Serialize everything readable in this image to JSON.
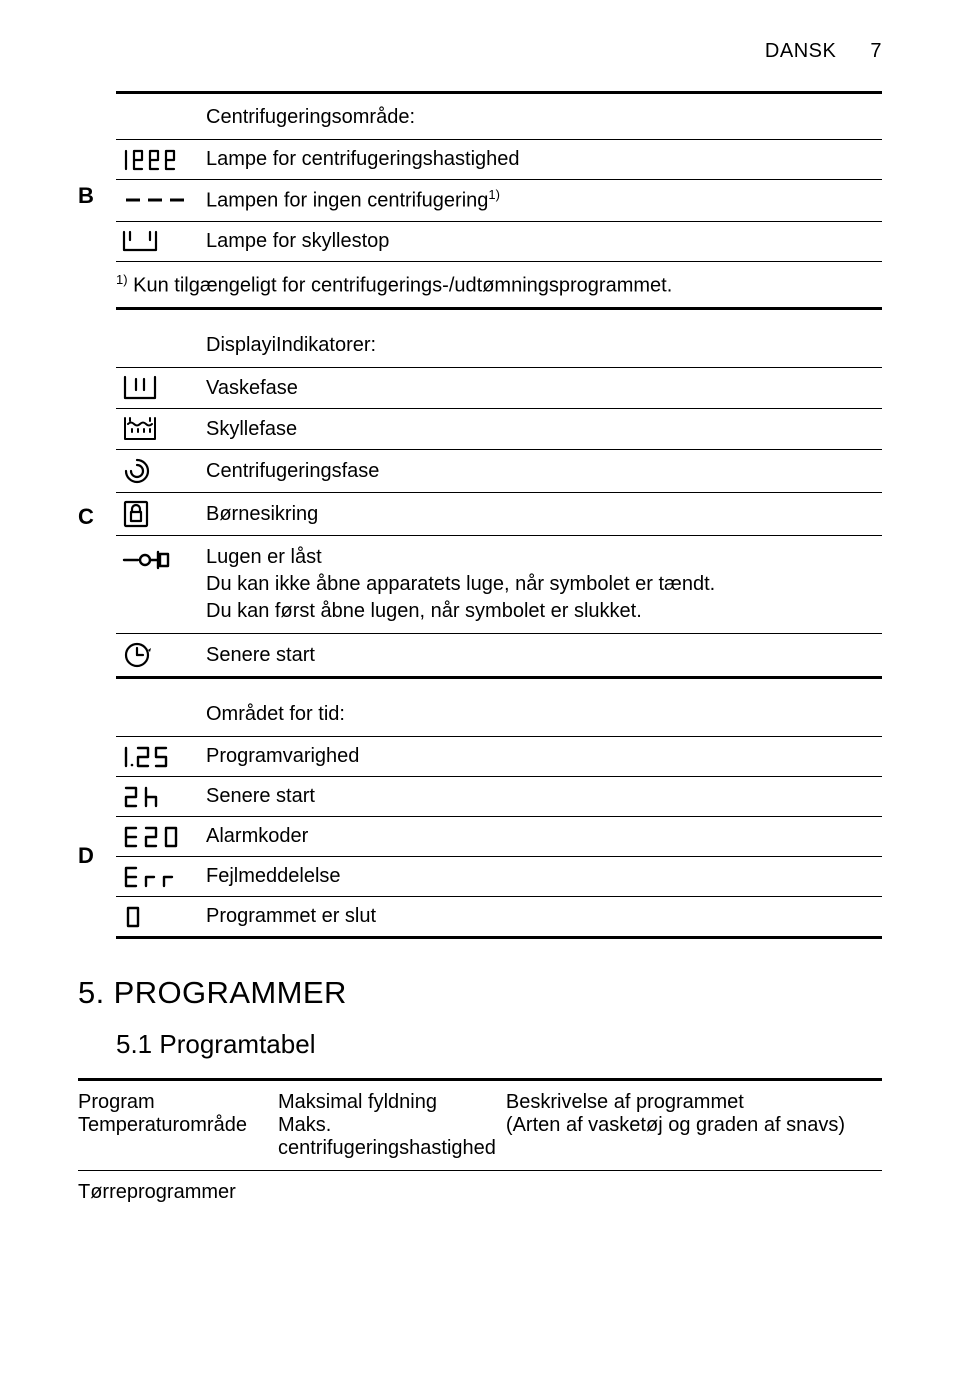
{
  "header": {
    "language": "DANSK",
    "page": "7"
  },
  "sectionB": {
    "letter": "B",
    "title": "Centrifugeringsområde:",
    "rows": [
      {
        "icon": "seg-1888",
        "label": "Lampe for centrifugeringshastighed"
      },
      {
        "icon": "dashes",
        "label_html": "Lampen for ingen centrifugering<sup>1)</sup>"
      },
      {
        "icon": "basin",
        "label": "Lampe for skyllestop"
      }
    ],
    "footnote_html": "<sup>1)</sup> Kun tilgængeligt for centrifugerings-/udtømningsprogrammet."
  },
  "sectionC": {
    "letter": "C",
    "title": "DisplayiIndikatorer:",
    "rows": [
      {
        "icon": "wash",
        "label": "Vaskefase"
      },
      {
        "icon": "rinse",
        "label": "Skyllefase"
      },
      {
        "icon": "spin",
        "label": "Centrifugeringsfase"
      },
      {
        "icon": "lock",
        "label": "Børnesikring"
      },
      {
        "icon": "keydoor",
        "label": "Lugen er låst\nDu kan ikke åbne apparatets luge, når symbolet er tændt.\nDu kan først åbne lugen, når symbolet er slukket."
      },
      {
        "icon": "clock",
        "label": "Senere start"
      }
    ]
  },
  "sectionD": {
    "letter": "D",
    "title": "Området for tid:",
    "rows": [
      {
        "icon": "seg-125",
        "label": "Programvarighed"
      },
      {
        "icon": "seg-2h",
        "label": "Senere start"
      },
      {
        "icon": "seg-e20",
        "label": "Alarmkoder"
      },
      {
        "icon": "seg-err",
        "label": "Fejlmeddelelse"
      },
      {
        "icon": "seg-0",
        "label": "Programmet er slut"
      }
    ]
  },
  "chapter": {
    "number": "5.",
    "title": "PROGRAMMER"
  },
  "subchapter": {
    "number": "5.1",
    "title": "Programtabel"
  },
  "progtable": {
    "col1": "Program\nTemperaturområde",
    "col2": "Maksimal fyldning\nMaks. centrifugeringshastighed",
    "col3": "Beskrivelse af programmet\n(Arten af vasketøj og graden af snavs)",
    "torre": "Tørreprogrammer"
  }
}
